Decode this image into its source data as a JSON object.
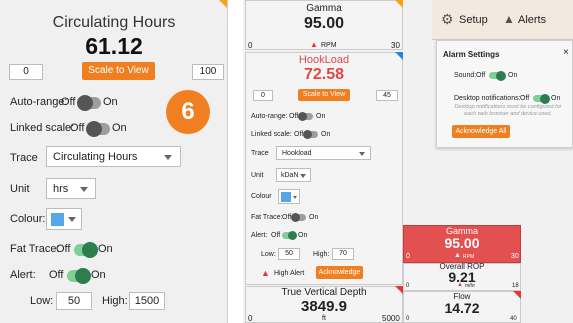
{
  "left": {
    "title": "Circulating Hours",
    "value": "61.12",
    "min": "0",
    "max": "100",
    "scale_button": "Scale to View",
    "badge": "6",
    "autorange": {
      "label": "Auto-range:",
      "off": "Off",
      "on": "On"
    },
    "linked": {
      "label": "Linked scale:",
      "off": "Off",
      "on": "On"
    },
    "trace": {
      "label": "Trace",
      "value": "Circulating Hours"
    },
    "unit": {
      "label": "Unit",
      "value": "hrs"
    },
    "colour": {
      "label": "Colour:"
    },
    "fat": {
      "label": "Fat Trace:",
      "off": "Off",
      "on": "On"
    },
    "alert": {
      "label": "Alert:",
      "off": "Off",
      "on": "On"
    },
    "low": {
      "label": "Low:",
      "value": "50"
    },
    "high": {
      "label": "High:",
      "value": "1500"
    }
  },
  "right": {
    "gamma_top": {
      "title": "Gamma",
      "value": "95.00",
      "unit": "RPM",
      "min": "0",
      "max": "30"
    },
    "hook": {
      "title": "HookLoad",
      "value": "72.58",
      "min": "0",
      "max": "45",
      "scale_button": "Scale to View",
      "autorange": {
        "label": "Auto-range:",
        "off": "Off",
        "on": "On"
      },
      "linked": {
        "label": "Linked scale:",
        "off": "Off",
        "on": "On"
      },
      "trace": {
        "label": "Trace",
        "value": "Hookload"
      },
      "unit": {
        "label": "Unit",
        "value": "kDaN"
      },
      "colour": {
        "label": "Colour"
      },
      "fat": {
        "label": "Fat Trace:",
        "off": "Off",
        "on": "On"
      },
      "alert": {
        "label": "Alert:",
        "off": "Off",
        "on": "On"
      },
      "low": {
        "label": "Low:",
        "value": "50"
      },
      "high": {
        "label": "High:",
        "value": "70"
      },
      "high_alert": "High Alert",
      "acknowledge": "Acknowledge"
    },
    "tvd": {
      "title": "True Vertical Depth",
      "value": "3849.9",
      "unit": "ft",
      "min": "0",
      "max": "5000"
    },
    "toolbar": {
      "setup": "Setup",
      "alerts": "Alerts"
    },
    "alarm": {
      "title": "Alarm Settings",
      "sound": {
        "label": "Sound:",
        "off": "Off",
        "on": "On"
      },
      "desktop": {
        "label": "Desktop notifications:",
        "off": "Off",
        "on": "On"
      },
      "note": "Desktop notifications must be configured for each web browser and device used.",
      "acknowledge_all": "Acknowledge All"
    },
    "gamma_red": {
      "title": "Gamma",
      "value": "95.00",
      "unit": "RPM",
      "min": "0",
      "max": "30"
    },
    "rop": {
      "title": "Overall ROP",
      "value": "9.21",
      "unit": "m/hr",
      "min": "0",
      "max": "18"
    },
    "flow": {
      "title": "Flow",
      "value": "14.72",
      "min": "0",
      "max": "40"
    }
  },
  "colors": {
    "accent": "#f07f22",
    "alert_red": "#e35050",
    "blue": "#1e88e5"
  }
}
